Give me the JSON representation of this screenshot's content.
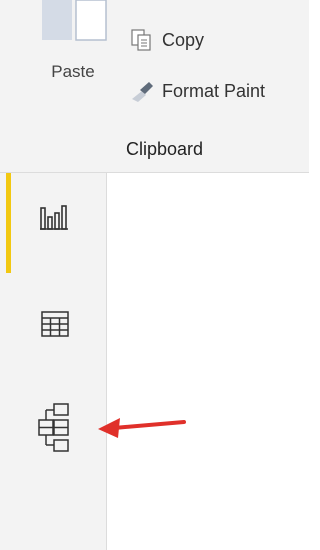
{
  "ribbon": {
    "paste_label": "Paste",
    "copy_label": "Copy",
    "format_painter_label": "Format Paint",
    "group_label": "Clipboard"
  },
  "leftnav": {
    "items": [
      {
        "name": "report-view",
        "icon": "bar-chart-icon",
        "active": true
      },
      {
        "name": "data-view",
        "icon": "table-grid-icon",
        "active": false
      },
      {
        "name": "model-view",
        "icon": "model-diagram-icon",
        "active": false
      }
    ],
    "active_color": "#f2c811"
  },
  "annotation": {
    "icon": "red-arrow-icon",
    "color": "#e0302a"
  }
}
